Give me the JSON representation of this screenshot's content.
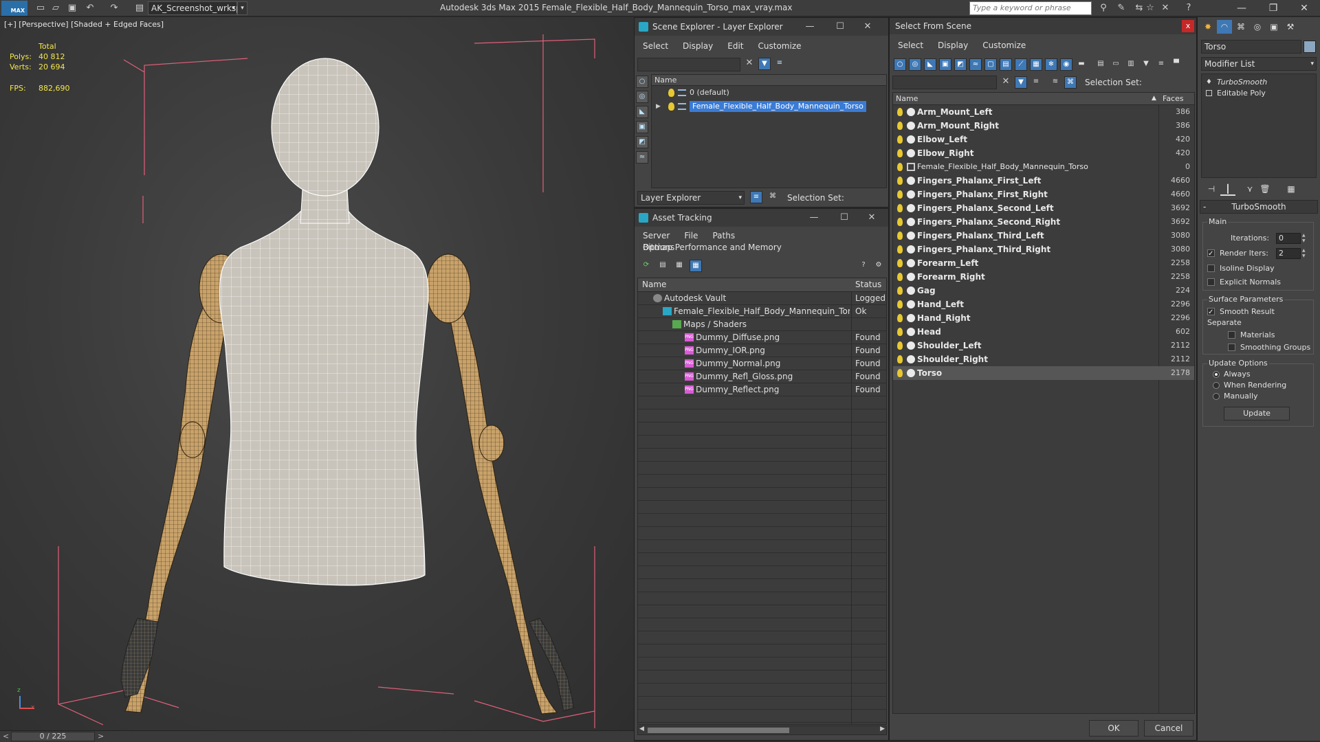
{
  "app": {
    "logo_text": "MAX",
    "workspace": "AK_Screenshot_wrksp",
    "window_title": "Autodesk 3ds Max  2015    Female_Flexible_Half_Body_Mannequin_Torso_max_vray.max",
    "search_placeholder": "Type a keyword or phrase"
  },
  "viewport": {
    "label": "[+] [Perspective] [Shaded + Edged Faces]",
    "stats": {
      "total_label": "Total",
      "polys_label": "Polys:",
      "polys_value": "40 812",
      "verts_label": "Verts:",
      "verts_value": "20 694",
      "fps_label": "FPS:",
      "fps_value": "882,690"
    },
    "axis_z": "z",
    "axis_x": "x"
  },
  "timeline": {
    "position": "0 / 225",
    "prev": "<",
    "next": ">"
  },
  "scene_explorer": {
    "title": "Scene Explorer - Layer Explorer",
    "menu": [
      "Select",
      "Display",
      "Edit",
      "Customize"
    ],
    "column_name": "Name",
    "layers": [
      {
        "name": "0 (default)",
        "selected": false
      },
      {
        "name": "Female_Flexible_Half_Body_Mannequin_Torso",
        "selected": true
      }
    ],
    "footer_select": "Layer Explorer",
    "selection_set_label": "Selection Set:"
  },
  "asset_tracking": {
    "title": "Asset Tracking",
    "menu": [
      "Server",
      "File",
      "Paths",
      "Bitmap Performance and Memory"
    ],
    "menu2": [
      "Options"
    ],
    "columns": {
      "name": "Name",
      "status": "Status"
    },
    "rows": [
      {
        "name": "Autodesk Vault",
        "status": "Logged",
        "indent": 1,
        "icon": "vault"
      },
      {
        "name": "Female_Flexible_Half_Body_Mannequin_Torso_...",
        "status": "Ok",
        "indent": 2,
        "icon": "maxfile"
      },
      {
        "name": "Maps / Shaders",
        "status": "",
        "indent": 3,
        "icon": "folder"
      },
      {
        "name": "Dummy_Diffuse.png",
        "status": "Found",
        "indent": 4,
        "icon": "png"
      },
      {
        "name": "Dummy_IOR.png",
        "status": "Found",
        "indent": 4,
        "icon": "png"
      },
      {
        "name": "Dummy_Normal.png",
        "status": "Found",
        "indent": 4,
        "icon": "png"
      },
      {
        "name": "Dummy_Refl_Gloss.png",
        "status": "Found",
        "indent": 4,
        "icon": "png"
      },
      {
        "name": "Dummy_Reflect.png",
        "status": "Found",
        "indent": 4,
        "icon": "png"
      }
    ]
  },
  "select_from_scene": {
    "title": "Select From Scene",
    "close": "x",
    "menu": [
      "Select",
      "Display",
      "Customize"
    ],
    "selection_set_label": "Selection Set:",
    "columns": {
      "name": "Name",
      "faces": "Faces",
      "sort_arrow": "▲"
    },
    "objects": [
      {
        "name": "Arm_Mount_Left",
        "faces": "386"
      },
      {
        "name": "Arm_Mount_Right",
        "faces": "386"
      },
      {
        "name": "Elbow_Left",
        "faces": "420"
      },
      {
        "name": "Elbow_Right",
        "faces": "420"
      },
      {
        "name": "Female_Flexible_Half_Body_Mannequin_Torso",
        "faces": "0",
        "group": true
      },
      {
        "name": "Fingers_Phalanx_First_Left",
        "faces": "4660"
      },
      {
        "name": "Fingers_Phalanx_First_Right",
        "faces": "4660"
      },
      {
        "name": "Fingers_Phalanx_Second_Left",
        "faces": "3692"
      },
      {
        "name": "Fingers_Phalanx_Second_Right",
        "faces": "3692"
      },
      {
        "name": "Fingers_Phalanx_Third_Left",
        "faces": "3080"
      },
      {
        "name": "Fingers_Phalanx_Third_Right",
        "faces": "3080"
      },
      {
        "name": "Forearm_Left",
        "faces": "2258"
      },
      {
        "name": "Forearm_Right",
        "faces": "2258"
      },
      {
        "name": "Gag",
        "faces": "224"
      },
      {
        "name": "Hand_Left",
        "faces": "2296"
      },
      {
        "name": "Hand_Right",
        "faces": "2296"
      },
      {
        "name": "Head",
        "faces": "602"
      },
      {
        "name": "Shoulder_Left",
        "faces": "2112"
      },
      {
        "name": "Shoulder_Right",
        "faces": "2112"
      },
      {
        "name": "Torso",
        "faces": "2178",
        "selected": true
      }
    ],
    "ok": "OK",
    "cancel": "Cancel"
  },
  "command_panel": {
    "object_name": "Torso",
    "modifier_list": "Modifier List",
    "stack": [
      {
        "name": "TurboSmooth",
        "type": "modifier"
      },
      {
        "name": "Editable Poly",
        "type": "base"
      }
    ],
    "rollout_title": "TurboSmooth",
    "rollout_minus": "-",
    "main_group": "Main",
    "iterations_label": "Iterations:",
    "iterations_value": "0",
    "render_iters_label": "Render Iters:",
    "render_iters_value": "2",
    "isoline_label": "Isoline Display",
    "explicit_normals_label": "Explicit Normals",
    "surface_group": "Surface Parameters",
    "smooth_result_label": "Smooth Result",
    "separate_label": "Separate",
    "materials_label": "Materials",
    "smoothing_groups_label": "Smoothing Groups",
    "update_group": "Update Options",
    "always_label": "Always",
    "when_rendering_label": "When Rendering",
    "manually_label": "Manually",
    "update_button": "Update"
  },
  "colors": {
    "selection_blue": "#3a7bd5",
    "bulb_yellow": "#e8c830",
    "stat_yellow": "#f5e84a",
    "close_red": "#c62828"
  }
}
